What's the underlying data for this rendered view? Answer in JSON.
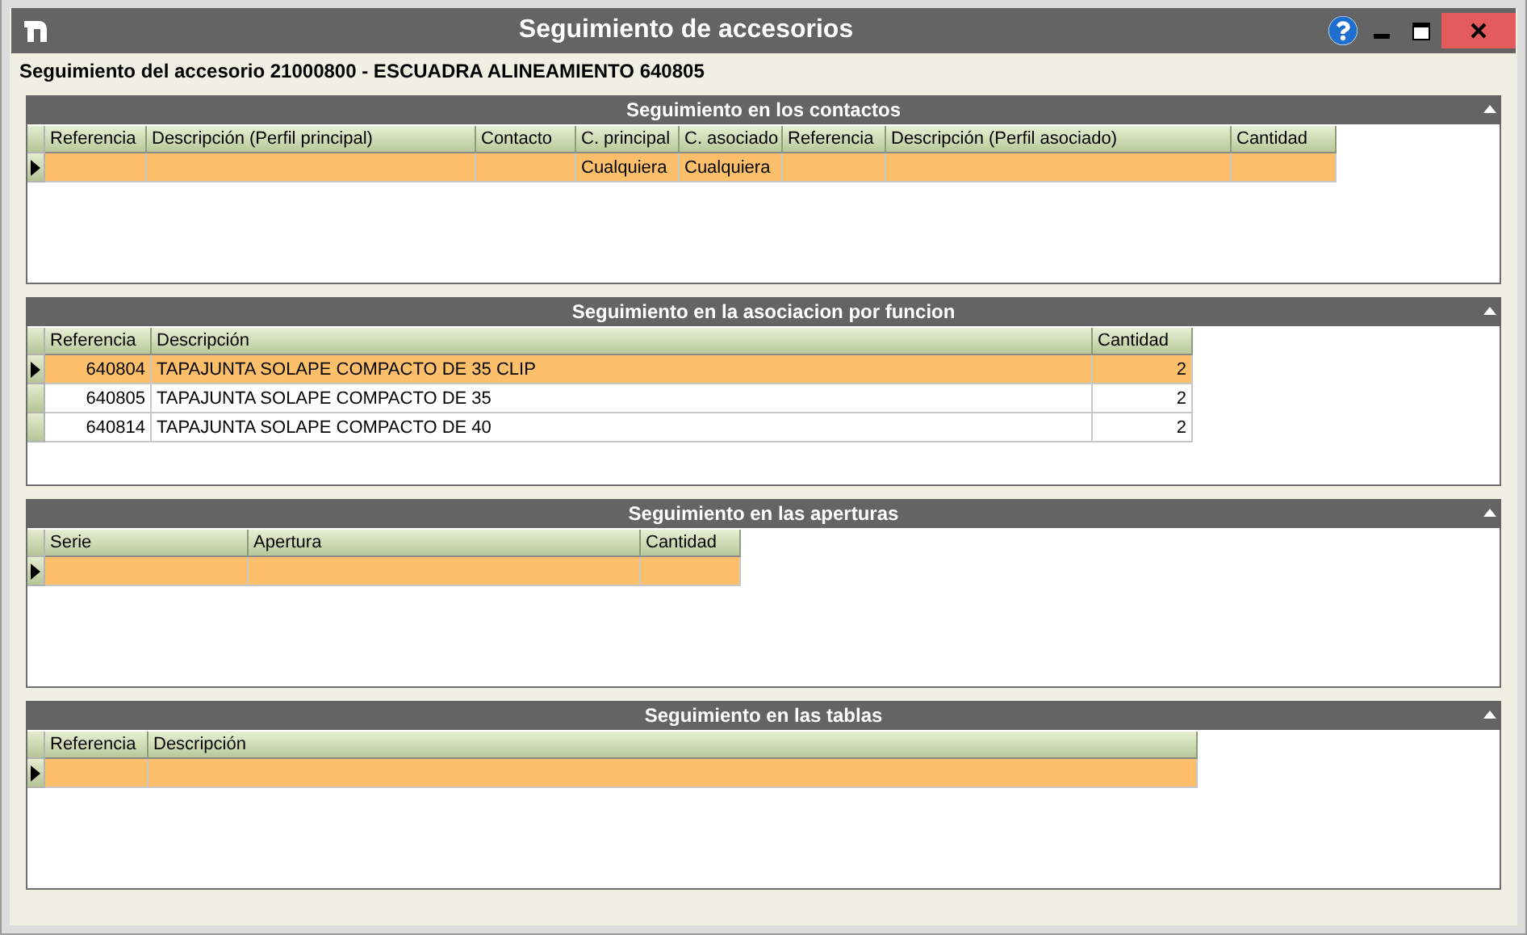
{
  "window": {
    "title": "Seguimiento de accesorios"
  },
  "subtitle": "Seguimiento del accesorio 21000800 - ESCUADRA ALINEAMIENTO 640805",
  "panels": [
    {
      "title": "Seguimiento en los contactos",
      "expanded": true,
      "columns": [
        "Referencia",
        "Descripción (Perfil principal)",
        "Contacto",
        "C. principal",
        "C. asociado",
        "Referencia",
        "Descripción (Perfil asociado)",
        "Cantidad"
      ],
      "rows": [
        {
          "selected": true,
          "cells": [
            null,
            null,
            null,
            "Cualquiera",
            "Cualquiera",
            null,
            null,
            null
          ]
        }
      ]
    },
    {
      "title": "Seguimiento en la asociacion por funcion",
      "expanded": true,
      "columns": [
        "Referencia",
        "Descripción",
        "Cantidad"
      ],
      "rows": [
        {
          "selected": true,
          "cells": [
            "640804",
            "TAPAJUNTA SOLAPE COMPACTO DE 35 CLIP",
            "2"
          ]
        },
        {
          "selected": false,
          "cells": [
            "640805",
            "TAPAJUNTA SOLAPE COMPACTO DE 35",
            "2"
          ]
        },
        {
          "selected": false,
          "cells": [
            "640814",
            "TAPAJUNTA SOLAPE COMPACTO DE 40",
            "2"
          ]
        }
      ]
    },
    {
      "title": "Seguimiento en las aperturas",
      "expanded": true,
      "columns": [
        "Serie",
        "Apertura",
        "Cantidad"
      ],
      "rows": [
        {
          "selected": true,
          "cells": [
            null,
            null,
            null
          ]
        }
      ]
    },
    {
      "title": "Seguimiento en las tablas",
      "expanded": true,
      "columns": [
        "Referencia",
        "Descripción"
      ],
      "rows": [
        {
          "selected": true,
          "cells": [
            null,
            null
          ]
        }
      ]
    }
  ]
}
